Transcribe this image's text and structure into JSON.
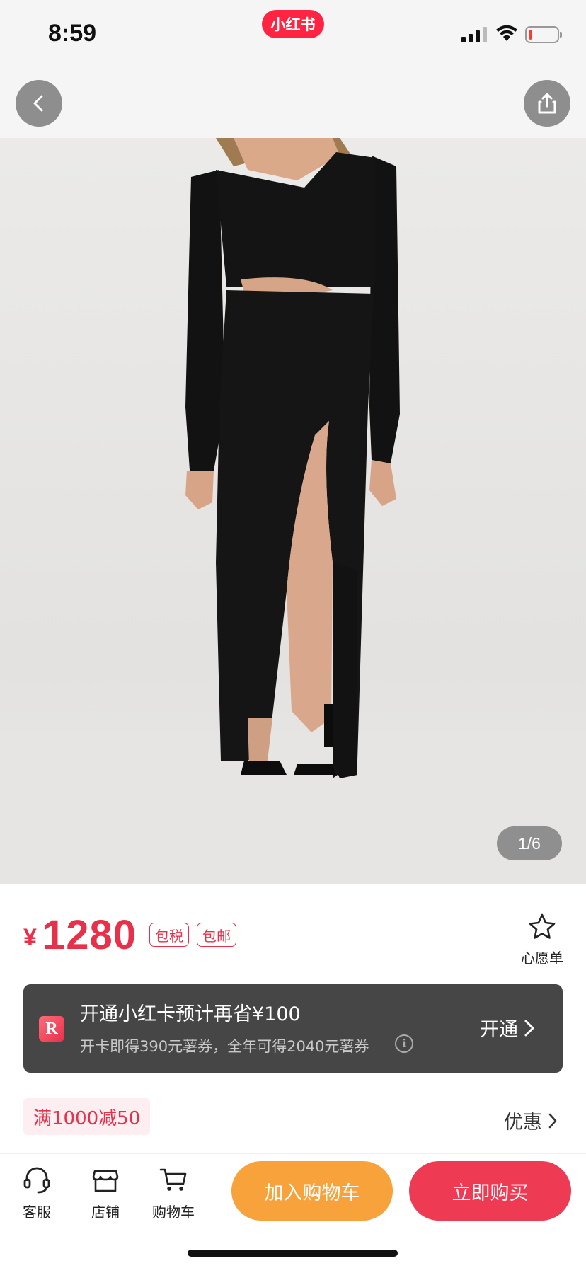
{
  "status_bar": {
    "time": "8:59",
    "app_badge": "小红书",
    "battery_level": 0.12,
    "battery_color": "#ff3b30"
  },
  "nav": {
    "back_icon": "chevron-left-icon",
    "share_icon": "share-icon"
  },
  "gallery": {
    "indicator": "1/6",
    "current": 1,
    "total": 6
  },
  "product": {
    "currency": "¥",
    "price": "1280",
    "tags": [
      "包税",
      "包邮"
    ],
    "wishlist_label": "心愿单"
  },
  "member_card": {
    "logo": "R",
    "title": "开通小红卡预计再省¥100",
    "subtitle": "开卡即得390元薯券，全年可得2040元薯券",
    "info_icon": "i",
    "action": "开通"
  },
  "discount": {
    "chip": "满1000减50",
    "more": "优惠"
  },
  "bottom_bar": {
    "service": "客服",
    "store": "店铺",
    "cart": "购物车",
    "add_to_cart": "加入购物车",
    "buy_now": "立即购买"
  },
  "colors": {
    "brand": "#ff2442",
    "price": "#e8304b",
    "add_to_cart": "#f7a23a",
    "buy_now": "#ee3a52",
    "banner_bg": "#464646"
  }
}
